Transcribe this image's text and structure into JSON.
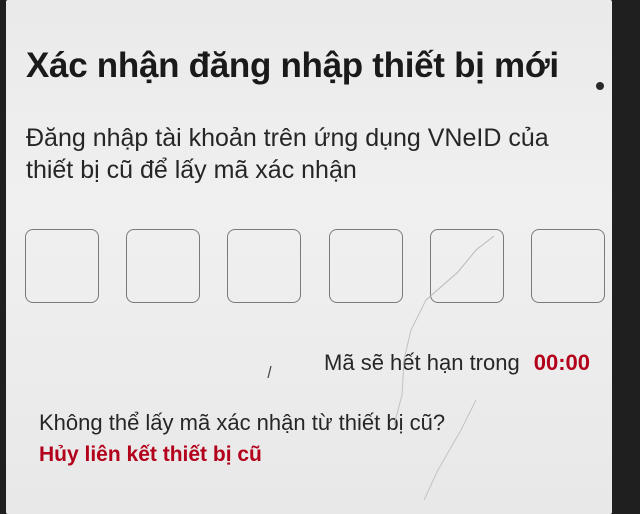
{
  "screen": {
    "title": "Xác nhận đăng nhập thiết bị mới",
    "description": "Đăng nhập tài khoản trên ứng dụng VNeID của thiết bị cũ để lấy mã xác nhận",
    "otp": {
      "digits": [
        "",
        "",
        "",
        "",
        "",
        ""
      ]
    },
    "expire": {
      "label": "Mã sẽ hết hạn trong",
      "time": "00:00"
    },
    "help": {
      "question": "Không thể lấy mã xác nhận từ thiết bị cũ?",
      "link_label": "Hủy liên kết thiết bị cũ"
    },
    "colors": {
      "accent": "#b3001b",
      "text": "#262626",
      "background": "#eeeeee",
      "box_border": "#7a7a7a"
    }
  }
}
